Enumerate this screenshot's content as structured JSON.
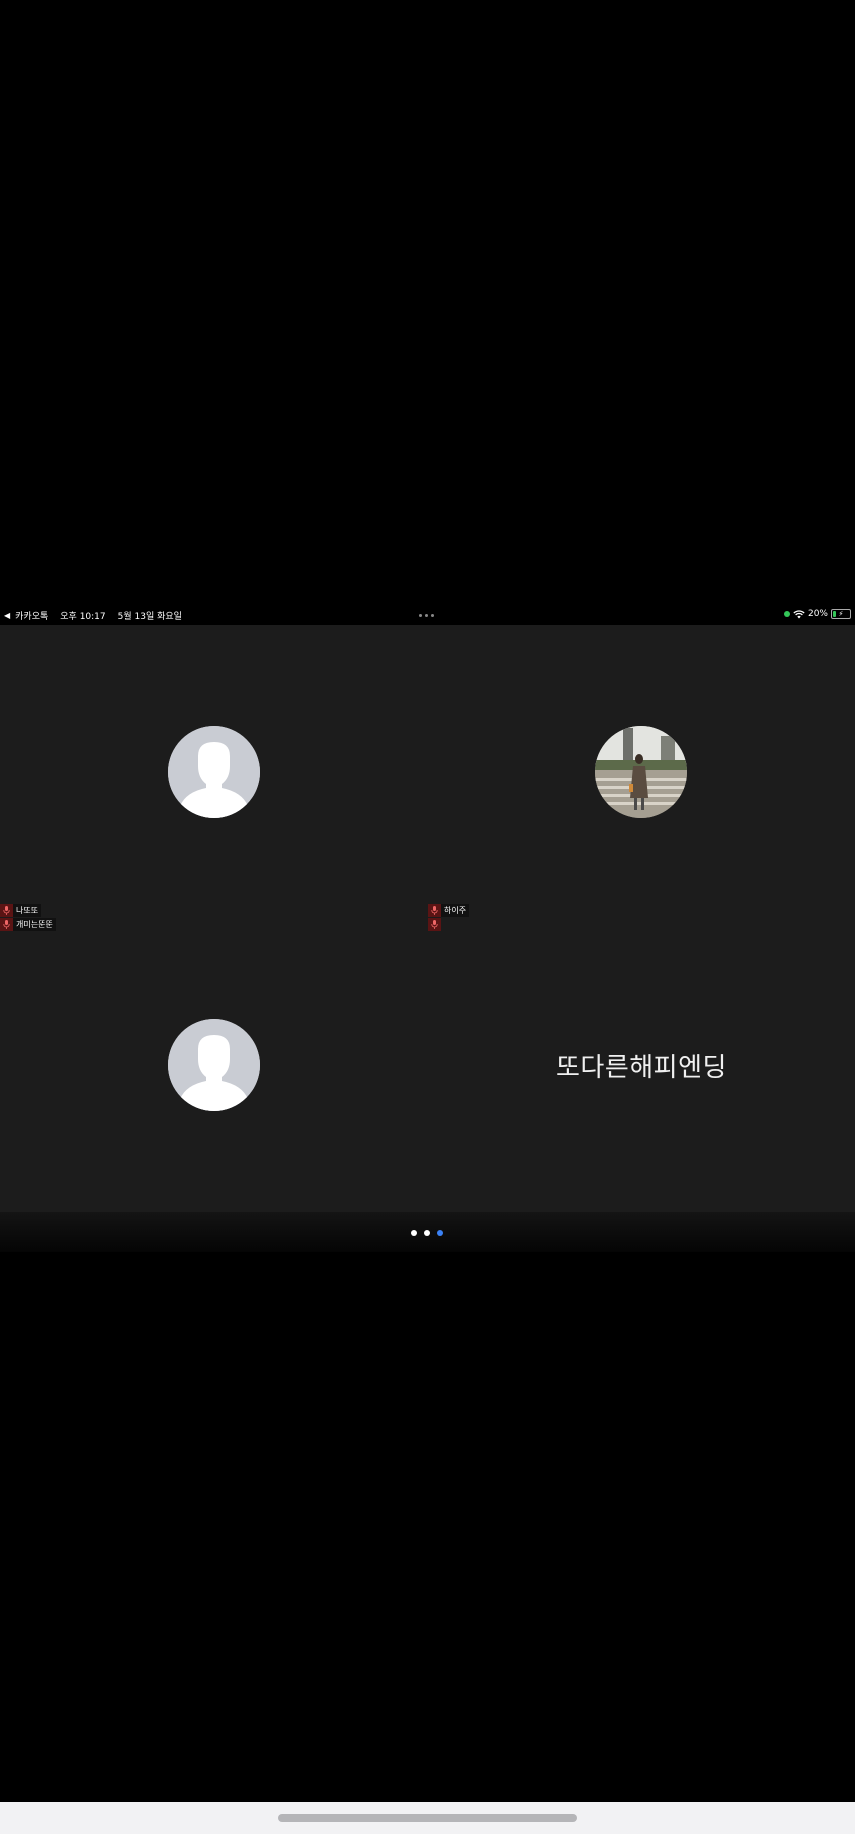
{
  "status_bar": {
    "back_app": "카카오톡",
    "time": "오후 10:17",
    "date": "5월 13일 화요일",
    "battery": "20%",
    "battery_level": 0.2
  },
  "participants": [
    {
      "names": [
        "나또또",
        "개미는뚠뚠"
      ],
      "avatar": "default-avatar"
    },
    {
      "names": [
        "하이주",
        ""
      ],
      "avatar": "photo-avatar"
    },
    {
      "names": [],
      "avatar": "default-avatar"
    },
    {
      "names": [],
      "display_name": "또다른해피엔딩"
    }
  ],
  "pager": {
    "count": 3,
    "active_index": 2
  },
  "colors": {
    "grid_bg": "#1c1c1c",
    "mic_bg": "#5a1414",
    "active_dot": "#3b82f6"
  },
  "icons": [
    "back-arrow-icon",
    "wifi-icon",
    "battery-icon",
    "mic-icon",
    "person-silhouette-icon"
  ]
}
